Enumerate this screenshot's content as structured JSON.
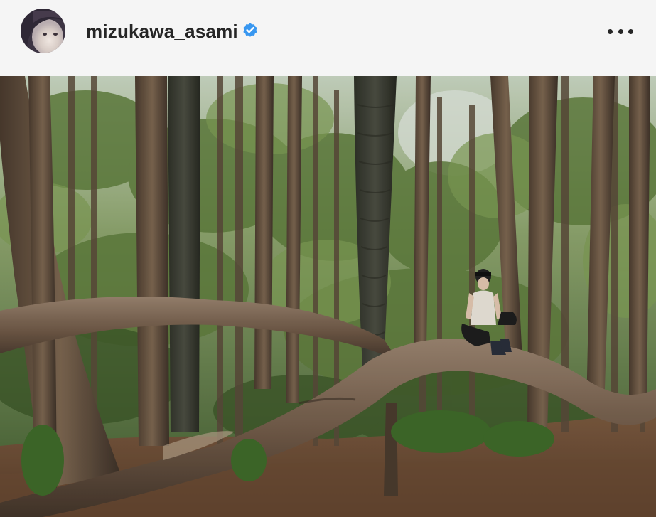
{
  "post": {
    "username": "mizukawa_asami",
    "verified": true,
    "more_options_icon": "more-horizontal-icon",
    "avatar_icon": "profile-avatar",
    "photo_icon": "forest-photo"
  },
  "colors": {
    "verified_badge": "#3897f0",
    "text": "#262626",
    "header_bg": "#f5f5f5"
  }
}
